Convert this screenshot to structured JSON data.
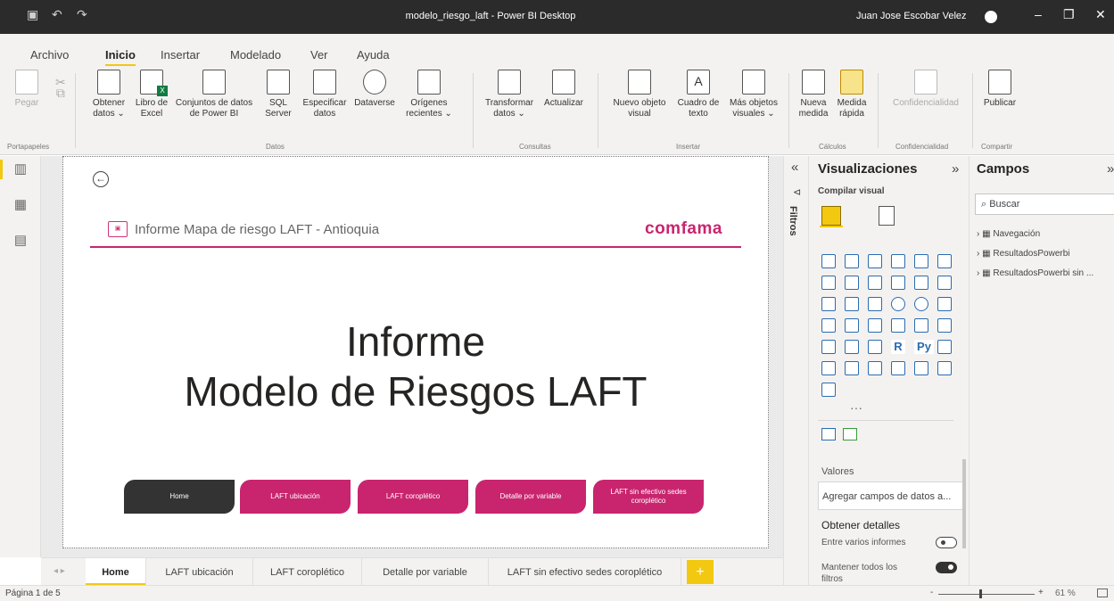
{
  "window": {
    "title": "modelo_riesgo_laft - Power BI Desktop",
    "user": "Juan Jose Escobar Velez",
    "icons": [
      "save-icon",
      "undo-icon",
      "redo-icon",
      "minimize-icon",
      "restore-icon",
      "close-icon"
    ]
  },
  "menu": {
    "items": [
      "Archivo",
      "Inicio",
      "Insertar",
      "Modelado",
      "Ver",
      "Ayuda"
    ],
    "active": "Inicio"
  },
  "ribbon": {
    "buttons": [
      {
        "label": "Pegar",
        "disabled": true
      },
      {
        "label": "Obtener datos ⌄"
      },
      {
        "label": "Libro de Excel"
      },
      {
        "label": "Conjuntos de datos de Power BI"
      },
      {
        "label": "SQL Server"
      },
      {
        "label": "Especificar datos"
      },
      {
        "label": "Dataverse"
      },
      {
        "label": "Orígenes recientes ⌄"
      },
      {
        "label": "Transformar datos ⌄"
      },
      {
        "label": "Actualizar"
      },
      {
        "label": "Nuevo objeto visual"
      },
      {
        "label": "Cuadro de texto"
      },
      {
        "label": "Más objetos visuales ⌄"
      },
      {
        "label": "Nueva medida"
      },
      {
        "label": "Medida rápida"
      },
      {
        "label": "Confidencialidad",
        "disabled": true
      },
      {
        "label": "Publicar"
      }
    ],
    "groups": [
      "Portapapeles",
      "Datos",
      "Consultas",
      "Insertar",
      "Cálculos",
      "Confidencialidad",
      "Compartir"
    ]
  },
  "report": {
    "header": "Informe Mapa de riesgo LAFT - Antioquia",
    "brand": "comfama",
    "title_line1": "Informe",
    "title_line2": "Modelo de Riesgos LAFT",
    "accent": "#c9256f",
    "nav_buttons": [
      "Home",
      "LAFT ubicación",
      "LAFT coroplético",
      "Detalle por variable",
      "LAFT sin efectivo sedes coroplético"
    ]
  },
  "pages": {
    "tabs": [
      "Home",
      "LAFT ubicación",
      "LAFT coroplético",
      "Detalle por variable",
      "LAFT sin efectivo sedes coroplético"
    ],
    "active": "Home",
    "add": "+"
  },
  "status": {
    "page": "Página 1 de 5",
    "zoom": "61 %",
    "zoom_minus": "-",
    "zoom_plus": "+"
  },
  "filters": {
    "label": "Filtros"
  },
  "visualizations": {
    "title": "Visualizaciones",
    "subtitle": "Compilar visual",
    "more": "···",
    "values_label": "Valores",
    "values_placeholder": "Agregar campos de datos a...",
    "drill_title": "Obtener detalles",
    "cross_report": "Entre varios informes",
    "cross_report_on": false,
    "keep_filters": "Mantener todos los filtros",
    "keep_filters_on": true,
    "r_label": "R",
    "py_label": "Py"
  },
  "fields": {
    "title": "Campos",
    "search_placeholder": "Buscar",
    "tables": [
      "Navegación",
      "ResultadosPowerbi",
      "ResultadosPowerbi sin ..."
    ]
  }
}
